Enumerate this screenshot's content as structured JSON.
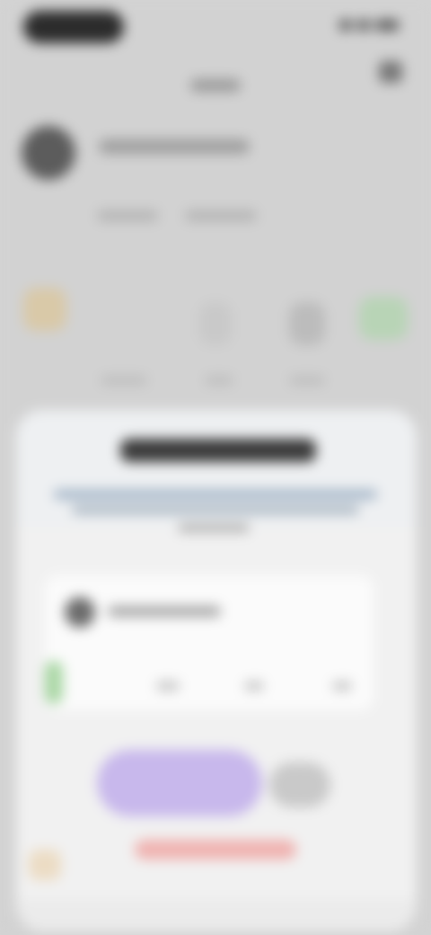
{
  "colors": {
    "primary_button": "#c8b8ec",
    "danger": "#f0b2b0",
    "accent_green": "#a9d7a4",
    "sheet_background": "#f1f1f1",
    "screen_background": "#d2d2d2"
  },
  "icons": {
    "top_bar_action": "settings-icon",
    "profile": "avatar",
    "preview_profile": "avatar"
  },
  "sheet": {
    "title": "",
    "description": "",
    "primary_button_label": "",
    "secondary_button_label": "",
    "danger_link_label": ""
  }
}
